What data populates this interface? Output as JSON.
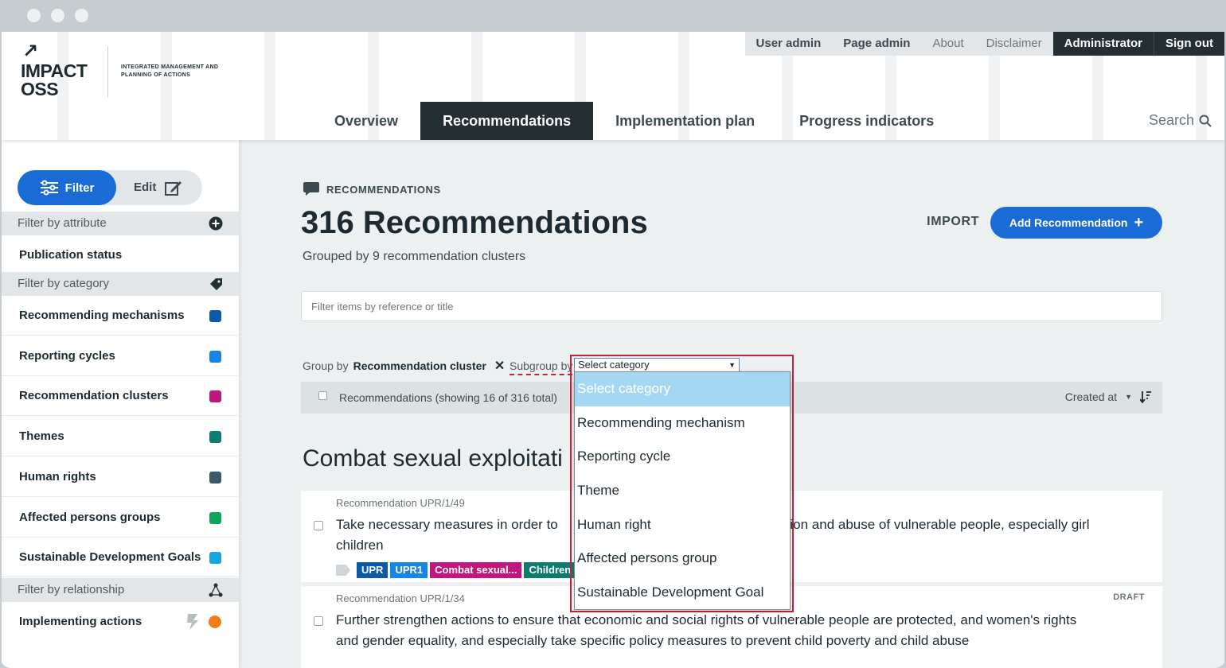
{
  "header": {
    "logo_title": "IMPACT OSS",
    "logo_line1": "IMPACT",
    "logo_line2": "OSS",
    "logo_subtitle": "INTEGRATED MANAGEMENT AND PLANNING OF ACTIONS",
    "top_nav": [
      "User admin",
      "Page admin",
      "About",
      "Disclaimer",
      "Administrator",
      "Sign out"
    ],
    "main_nav": [
      "Overview",
      "Recommendations",
      "Implementation plan",
      "Progress indicators"
    ],
    "active_main_nav": "Recommendations",
    "search_label": "Search"
  },
  "sidebar": {
    "filter_label": "Filter",
    "edit_label": "Edit",
    "section_attribute": "Filter by attribute",
    "publication_status": "Publication status",
    "section_category": "Filter by category",
    "categories": [
      {
        "label": "Recommending mechanisms",
        "color": "#0a5aa8"
      },
      {
        "label": "Reporting cycles",
        "color": "#1685e8"
      },
      {
        "label": "Recommendation clusters",
        "color": "#c2167d"
      },
      {
        "label": "Themes",
        "color": "#0d7c6e"
      },
      {
        "label": "Human rights",
        "color": "#3e5870"
      },
      {
        "label": "Affected persons groups",
        "color": "#10a55c"
      },
      {
        "label": "Sustainable Development Goals",
        "color": "#17a6df"
      }
    ],
    "section_relationship": "Filter by relationship",
    "implementing_actions": "Implementing actions",
    "implementing_color": "#f07f1a"
  },
  "main": {
    "kicker": "RECOMMENDATIONS",
    "title": "316 Recommendations",
    "subtitle": "Grouped by 9 recommendation clusters",
    "import_label": "IMPORT",
    "add_label": "Add Recommendation",
    "filter_placeholder": "Filter items by reference or title",
    "group_by_label": "Group by",
    "group_by_value": "Recommendation cluster",
    "subgroup_label": "Subgroup by",
    "list_summary": "Recommendations (showing 16 of 316 total)",
    "sort_label": "Created at",
    "cluster_title": "Combat sexual exploitati",
    "recommendations": [
      {
        "ref": "Recommendation UPR/1/49",
        "text_start": "Take necessary measures in order to",
        "text_end": "ation and abuse of vulnerable people, especially girl",
        "text_line2": "children",
        "tags": [
          {
            "label": "UPR",
            "color": "#0a5aa8"
          },
          {
            "label": "UPR1",
            "color": "#1685e8"
          },
          {
            "label": "Combat sexual...",
            "color": "#c2167d"
          },
          {
            "label": "Children",
            "color": "#0d7c6e"
          }
        ]
      },
      {
        "ref": "Recommendation UPR/1/34",
        "status": "DRAFT",
        "text_line1": "Further strengthen actions to ensure that economic and social rights of vulnerable people are protected, and women's rights",
        "text_line2": "and gender equality, and especially take specific policy measures to prevent child poverty and child abuse"
      }
    ]
  },
  "dropdown": {
    "selected": "Select category",
    "options": [
      "Select category",
      "Recommending mechanism",
      "Reporting cycle",
      "Theme",
      "Human right",
      "Affected persons group",
      "Sustainable Development Goal"
    ]
  },
  "colors": {
    "accent": "#1a6bd6",
    "dark_nav": "#232f33",
    "highlight_border": "#c0263b"
  }
}
